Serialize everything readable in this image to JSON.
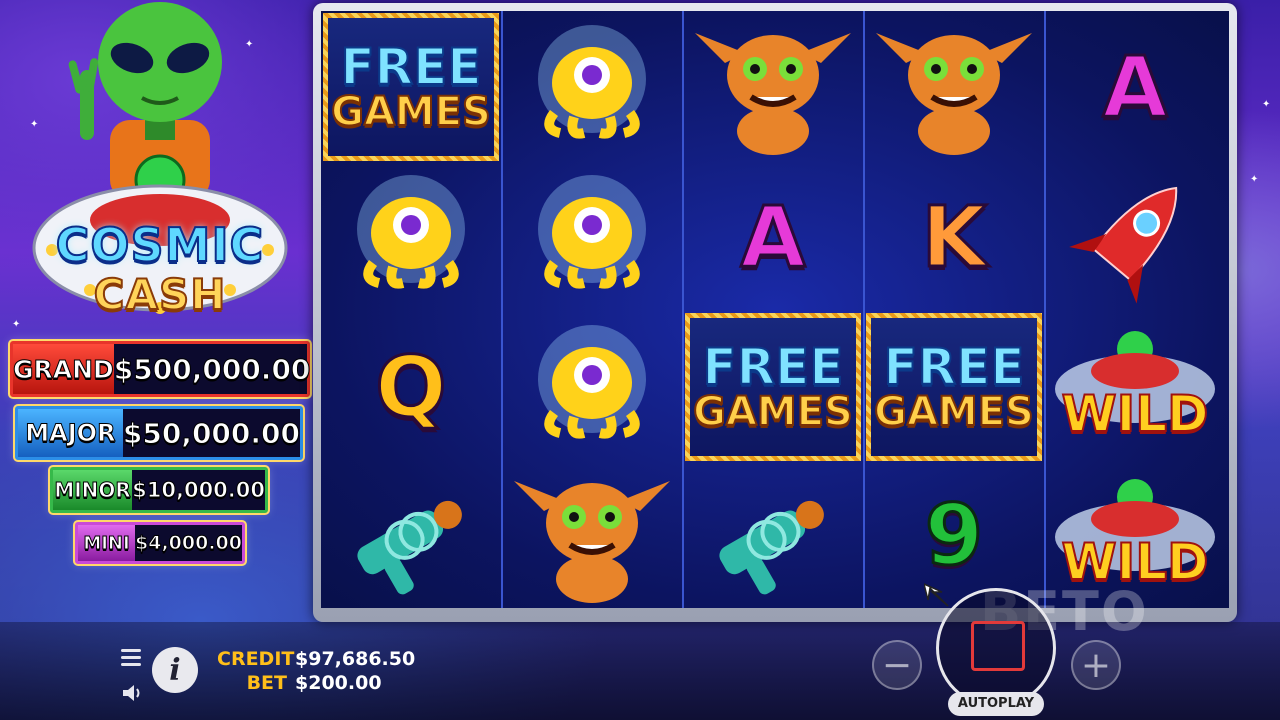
{
  "game": {
    "logo_line1": "COSMIC",
    "logo_line2": "CASH"
  },
  "jackpots": [
    {
      "label": "GRAND",
      "value": "$500,000.00",
      "color": "#e8342b"
    },
    {
      "label": "MAJOR",
      "value": "$50,000.00",
      "color": "#2b8ee8"
    },
    {
      "label": "MINOR",
      "value": "$10,000.00",
      "color": "#36b94a"
    },
    {
      "label": "MINI",
      "value": "$4,000.00",
      "color": "#c94ad8"
    }
  ],
  "reels": {
    "symbols": {
      "free_games": {
        "line1": "FREE",
        "line2": "GAMES"
      },
      "wild": "WILD",
      "letter_a": "A",
      "letter_k": "K",
      "letter_q": "Q",
      "number_9": "9"
    },
    "grid": [
      [
        "free-games",
        "yellow-octopus-alien",
        "orange-gremlin",
        "orange-gremlin",
        "A"
      ],
      [
        "yellow-octopus-alien",
        "yellow-octopus-alien",
        "A",
        "K",
        "red-rocket"
      ],
      [
        "Q",
        "yellow-octopus-alien",
        "free-games",
        "free-games",
        "wild"
      ],
      [
        "ray-gun",
        "orange-gremlin",
        "ray-gun",
        "9",
        "wild"
      ]
    ]
  },
  "meters": {
    "credit_label": "CREDIT",
    "credit_value": "$97,686.50",
    "bet_label": "BET",
    "bet_value": "$200.00"
  },
  "controls": {
    "autoplay_label": "AUTOPLAY",
    "minus_label": "−",
    "plus_label": "+",
    "info_label": "i"
  },
  "watermark": "BETO"
}
